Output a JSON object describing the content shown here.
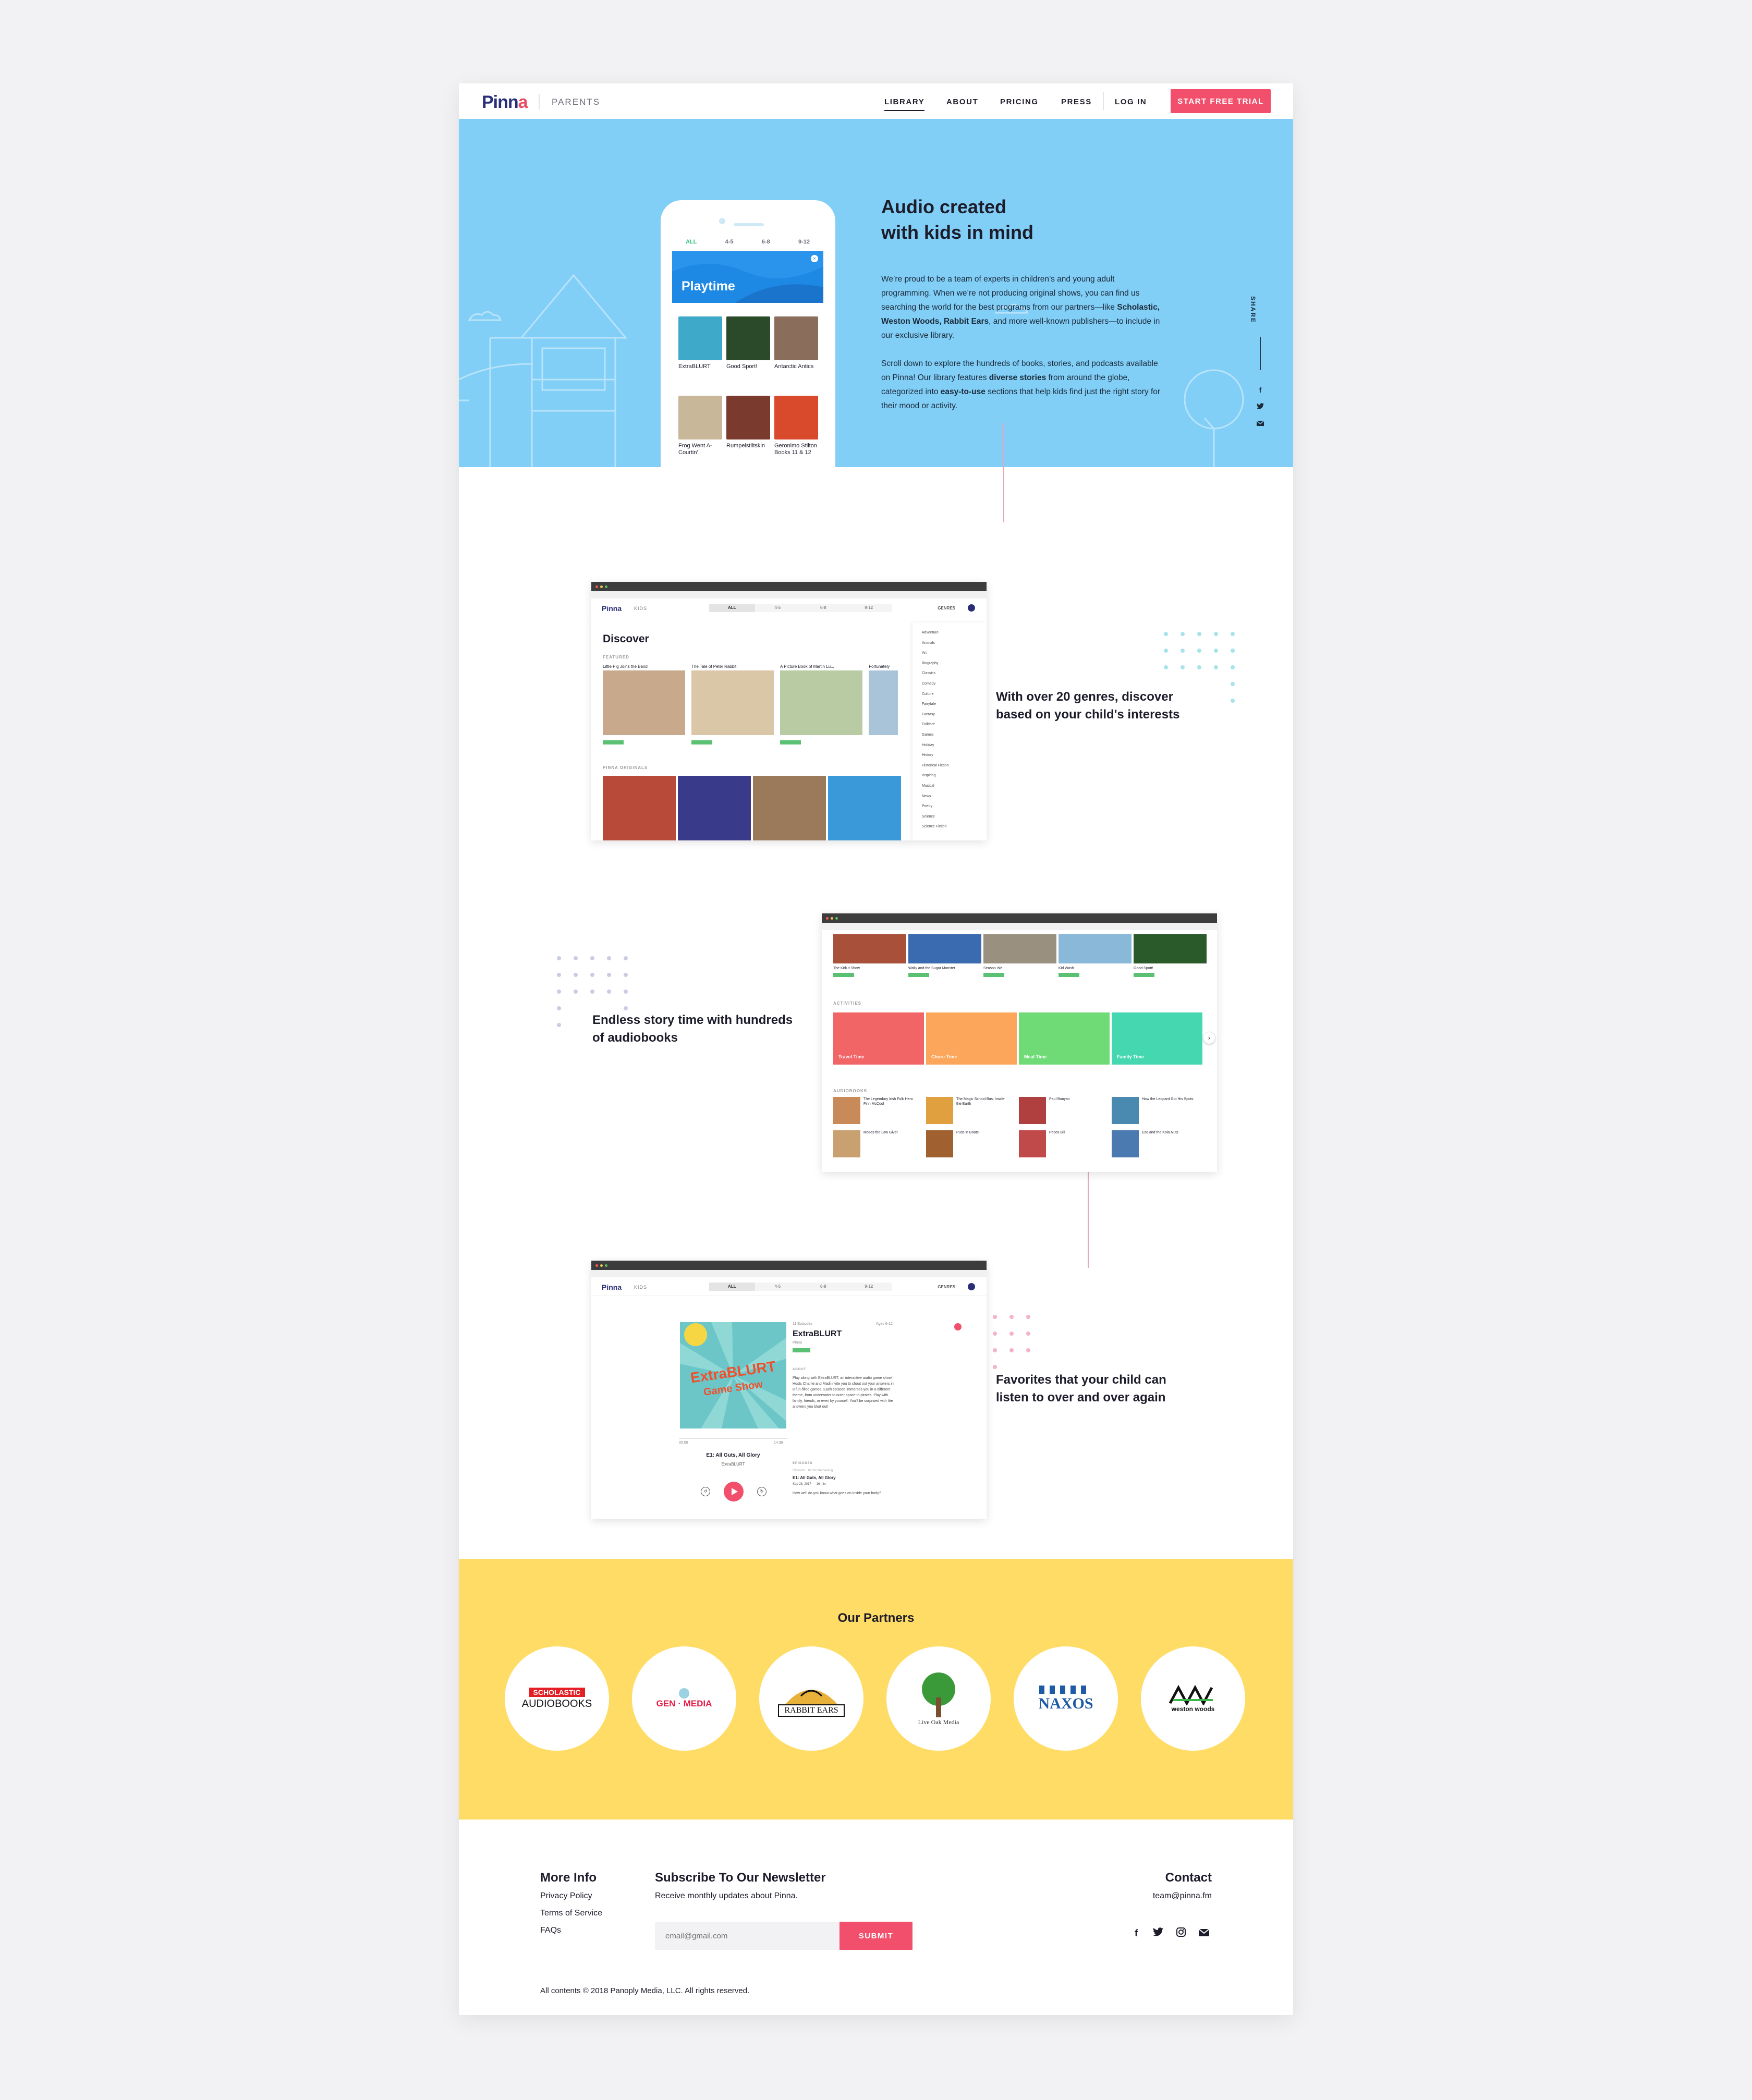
{
  "nav": {
    "logo_pre": "Pinn",
    "logo_o": "a",
    "section": "PARENTS",
    "links": [
      "LIBRARY",
      "ABOUT",
      "PRICING",
      "PRESS",
      "LOG IN"
    ],
    "cta": "START FREE TRIAL"
  },
  "hero": {
    "title_line1": "Audio created",
    "title_line2": "with kids in mind",
    "p1_a": "We’re proud to be a team of experts in children’s and young adult programming. When we’re not producing original shows, you can find us searching the world for the best programs from our partners—like ",
    "p1_b": "Scholastic, Weston Woods, Rabbit Ears",
    "p1_c": ", and more well-known publishers—to include in our exclusive library.",
    "p2_a": "Scroll down to explore the hundreds of books, stories, and podcasts available on Pinna! Our library features ",
    "p2_b": "diverse stories",
    "p2_c": " from around the globe, categorized into ",
    "p2_d": "easy-to-use",
    "p2_e": " sections that help kids find just the right story for their mood or activity.",
    "share": "SHARE",
    "share_icons": [
      "facebook-icon",
      "twitter-icon",
      "mail-icon"
    ],
    "phone": {
      "tabs": [
        "ALL",
        "4-5",
        "6-8",
        "9-12"
      ],
      "banner": "Playtime",
      "books": [
        {
          "title": "ExtraBLURT",
          "color": "#3fa9c9"
        },
        {
          "title": "Good Sport!",
          "color": "#2b4a2a"
        },
        {
          "title": "Antarctic Antics",
          "color": "#8a6d5a"
        },
        {
          "title": "Frog Went A-Courtin'",
          "color": "#c9b79a"
        },
        {
          "title": "Rumpelstiltskin",
          "color": "#7a3b2e"
        },
        {
          "title": "Geronimo Stilton Books 11 & 12",
          "color": "#d94a2c"
        }
      ]
    }
  },
  "features": [
    {
      "title_line1": "With over 20 genres, discover",
      "title_line2": "based on your child's interests"
    },
    {
      "title_line1": "Endless story time with hundreds",
      "title_line2": "of audiobooks"
    },
    {
      "title_line1": "Favorites that your child can",
      "title_line2": "listen to over and over again"
    }
  ],
  "shot1": {
    "logo": "Pinna",
    "kids": "KIDS",
    "tabs": [
      "ALL",
      "4-5",
      "6-8",
      "9-12"
    ],
    "genres_btn": "GENRES",
    "heading": "Discover",
    "featured_label": "FEATURED",
    "originals_label": "PINNA ORIGINALS",
    "featured": [
      {
        "title": "Little Pig Joins the Band",
        "color": "#c8a98c"
      },
      {
        "title": "The Tale of Peter Rabbit",
        "color": "#d9c7a8"
      },
      {
        "title": "A Picture Book of Martin Lu...",
        "color": "#b9cba2"
      },
      {
        "title": "Fortunately",
        "color": "#a9c4d9"
      }
    ],
    "originals_colors": [
      "#b84a3a",
      "#3a3a8a",
      "#9a7a5a",
      "#3a9ad9"
    ],
    "genres": [
      "Adventure",
      "Animals",
      "Art",
      "Biography",
      "Classics",
      "Comedy",
      "Culture",
      "Fairytale",
      "Fantasy",
      "Folklore",
      "Games",
      "Holiday",
      "History",
      "Historical Fiction",
      "Inspiring",
      "Musical",
      "News",
      "Poetry",
      "Science",
      "Science Fiction"
    ]
  },
  "shot2": {
    "top_books": [
      {
        "title": "The KidLit Show",
        "color": "#a8503a"
      },
      {
        "title": "Wally and the Sugar Monster",
        "color": "#3a6ab0"
      },
      {
        "title": "Season Isle",
        "color": "#9a9080"
      },
      {
        "title": "Kid Wash",
        "color": "#8ab8d9"
      },
      {
        "title": "Good Sport!",
        "color": "#2b5a2a"
      }
    ],
    "activities_label": "ACTIVITIES",
    "activities": [
      {
        "label": "Travel Time",
        "color": "#f16567"
      },
      {
        "label": "Chore Time",
        "color": "#fba65a"
      },
      {
        "label": "Meal Time",
        "color": "#6fdb76"
      },
      {
        "label": "Family Time",
        "color": "#45d8b0"
      }
    ],
    "audiobooks_label": "AUDIOBOOKS",
    "audiobooks": [
      {
        "title": "The Legendary Irish Folk Hero Finn McCool",
        "color": "#c98a5a"
      },
      {
        "title": "The Magic School Bus: Inside the Earth",
        "color": "#e0a040"
      },
      {
        "title": "Paul Bunyan",
        "color": "#b04040"
      },
      {
        "title": "How the Leopard Got His Spots",
        "color": "#4a8ab0"
      },
      {
        "title": "Moses the Law Giver",
        "color": "#c9a070"
      },
      {
        "title": "Puss in Boots",
        "color": "#a06030"
      },
      {
        "title": "Pecos Bill",
        "color": "#c04a4a"
      },
      {
        "title": "Ezo and the Kola Nuts",
        "color": "#4a7ab0"
      }
    ]
  },
  "shot3": {
    "logo": "Pinna",
    "kids": "KIDS",
    "tabs": [
      "ALL",
      "4-5",
      "6-8",
      "9-12"
    ],
    "genres_btn": "GENRES",
    "episodes_count": "11 Episodes",
    "ages": "Ages 6-12",
    "show_title": "ExtraBLURT",
    "publisher": "Pinna",
    "about_label": "ABOUT",
    "about": "Play along with ExtraBLURT, an interactive audio game show! Hosts Charlie and Madi invite you to shout out your answers in 8 fun-filled games. Each episode immerses you in a different theme, from underwater to outer space to pirates. Play with family, friends, or even by yourself. You'll be surprised with the answers you blurt out!",
    "episodes_label": "EPISODES",
    "ep_meta1": "Chorvibs",
    "ep_meta2": "16 min Remaining",
    "ep_title": "E1: All Guts, All Glory",
    "ep_date": "Sep 28, 2017",
    "ep_dur": "16 min",
    "ep_desc": "How well do you know what goes on inside your body?",
    "cover_line1": "ExtraBLURT",
    "cover_line2": "Game Show",
    "time_start": "00:00",
    "time_end": "14:36",
    "player_title": "E1: All Guts, All Glory",
    "player_show": "ExtraBLURT"
  },
  "partners": {
    "title": "Our Partners",
    "items": [
      {
        "line1": "SCHOLASTIC",
        "line2": "AUDIOBOOKS"
      },
      {
        "line1": "GEN",
        "line2": "MEDIA"
      },
      {
        "line1": "RABBIT EARS",
        "line2": ""
      },
      {
        "line1": "Live Oak Media",
        "line2": ""
      },
      {
        "line1": "NAXOS",
        "line2": ""
      },
      {
        "line1": "weston woods",
        "line2": ""
      }
    ]
  },
  "footer": {
    "more_info": "More Info",
    "links": [
      "Privacy Policy",
      "Terms of Service",
      "FAQs"
    ],
    "newsletter_title": "Subscribe To Our Newsletter",
    "newsletter_sub": "Receive monthly updates about Pinna.",
    "email_placeholder": "email@gmail.com",
    "submit": "SUBMIT",
    "contact": "Contact",
    "email": "team@pinna.fm",
    "social_icons": [
      "facebook-icon",
      "twitter-icon",
      "instagram-icon",
      "mail-icon"
    ],
    "copyright": "All contents © 2018 Panoply Media, LLC. All rights reserved."
  },
  "colors": {
    "accent": "#f14f6b",
    "hero_bg": "#81cff7",
    "partners_bg": "#ffdc65",
    "navy": "#2a2e78"
  }
}
